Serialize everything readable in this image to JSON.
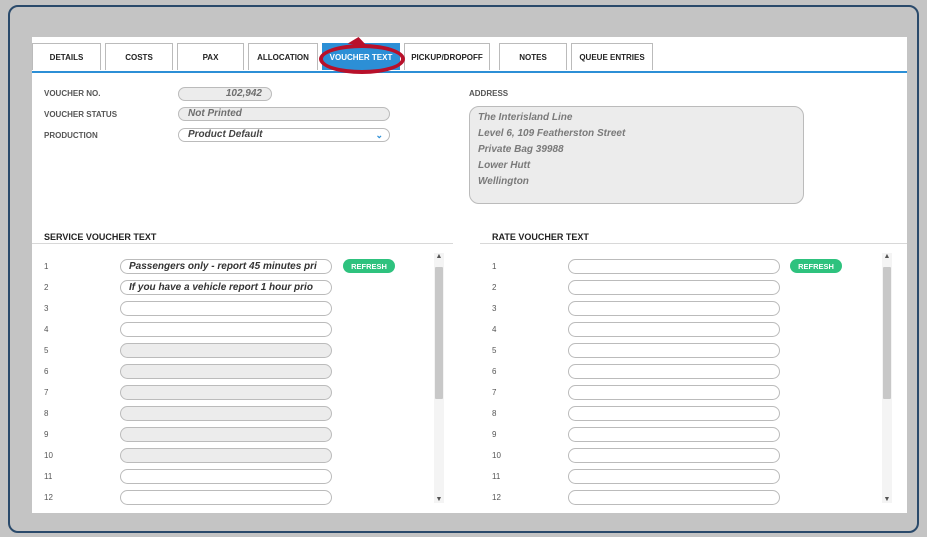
{
  "tabs": [
    {
      "label": "DETAILS"
    },
    {
      "label": "COSTS"
    },
    {
      "label": "PAX"
    },
    {
      "label": "ALLOCATION"
    },
    {
      "label": "VOUCHER TEXT"
    },
    {
      "label": "PICKUP/DROPOFF"
    },
    {
      "label": "NOTES"
    },
    {
      "label": "QUEUE ENTRIES"
    }
  ],
  "active_tab": "VOUCHER TEXT",
  "voucher": {
    "no_label": "VOUCHER NO.",
    "no_value": "102,942",
    "status_label": "VOUCHER STATUS",
    "status_value": "Not Printed",
    "production_label": "PRODUCTION",
    "production_value": "Product Default"
  },
  "address": {
    "label": "ADDRESS",
    "lines": [
      "The Interisland Line",
      "Level 6, 109 Featherston Street",
      "Private Bag 39988",
      "Lower Hutt",
      "Wellington"
    ]
  },
  "service": {
    "title": "SERVICE VOUCHER TEXT",
    "refresh_label": "REFRESH",
    "rows": [
      {
        "n": "1",
        "text": "Passengers only - report 45 minutes pri"
      },
      {
        "n": "2",
        "text": "If you have a vehicle report 1 hour prio"
      },
      {
        "n": "3",
        "text": ""
      },
      {
        "n": "4",
        "text": ""
      },
      {
        "n": "5",
        "text": ""
      },
      {
        "n": "6",
        "text": ""
      },
      {
        "n": "7",
        "text": ""
      },
      {
        "n": "8",
        "text": ""
      },
      {
        "n": "9",
        "text": ""
      },
      {
        "n": "10",
        "text": ""
      },
      {
        "n": "11",
        "text": ""
      },
      {
        "n": "12",
        "text": ""
      }
    ]
  },
  "rate": {
    "title": "RATE VOUCHER TEXT",
    "refresh_label": "REFRESH",
    "rows": [
      {
        "n": "1",
        "text": ""
      },
      {
        "n": "2",
        "text": ""
      },
      {
        "n": "3",
        "text": ""
      },
      {
        "n": "4",
        "text": ""
      },
      {
        "n": "5",
        "text": ""
      },
      {
        "n": "6",
        "text": ""
      },
      {
        "n": "7",
        "text": ""
      },
      {
        "n": "8",
        "text": ""
      },
      {
        "n": "9",
        "text": ""
      },
      {
        "n": "10",
        "text": ""
      },
      {
        "n": "11",
        "text": ""
      },
      {
        "n": "12",
        "text": ""
      }
    ]
  },
  "icons": {
    "chevron": "chevron-down-icon",
    "scroll_up": "scroll-up-icon",
    "scroll_down": "scroll-down-icon"
  },
  "colors": {
    "accent": "#2c8fd6",
    "refresh": "#2ec27e",
    "highlight": "#b8102a"
  }
}
